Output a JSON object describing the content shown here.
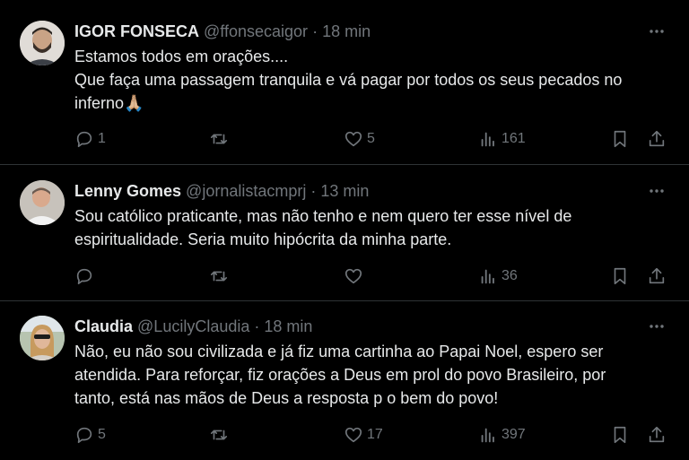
{
  "tweets": [
    {
      "name": "IGOR FONSECA",
      "handle": "@ffonsecaigor",
      "dot": "·",
      "time": "18 min",
      "lines": [
        "Estamos todos em orações....",
        "Que faça uma passagem tranquila e vá pagar por todos os seus pecados no",
        "inferno🙏🏼"
      ],
      "replies": "1",
      "retweets": "",
      "likes": "5",
      "views": "161"
    },
    {
      "name": "Lenny Gomes",
      "handle": "@jornalistacmprj",
      "dot": "·",
      "time": "13 min",
      "lines": [
        "Sou católico praticante, mas  não tenho e nem quero ter esse nível de",
        "espiritualidade.  Seria muito hipócrita da minha parte."
      ],
      "replies": "",
      "retweets": "",
      "likes": "",
      "views": "36"
    },
    {
      "name": "Claudia",
      "handle": "@LucilyClaudia",
      "dot": "·",
      "time": "18 min",
      "lines": [
        "Não, eu não sou civilizada e já fiz uma cartinha ao Papai Noel, espero ser",
        "atendida. Para reforçar, fiz orações a Deus em prol do povo Brasileiro, por",
        "tanto, está nas mãos de Deus a resposta p o bem do povo!"
      ],
      "replies": "5",
      "retweets": "",
      "likes": "17",
      "views": "397"
    }
  ],
  "icons": {
    "reply": "reply-icon",
    "retweet": "retweet-icon",
    "like": "heart-icon",
    "views": "views-icon",
    "bookmark": "bookmark-icon",
    "share": "share-icon",
    "more": "more-icon"
  },
  "colors": {
    "background": "#000000",
    "text": "#e7e9ea",
    "secondary": "#71767b",
    "divider": "#2f3336"
  }
}
